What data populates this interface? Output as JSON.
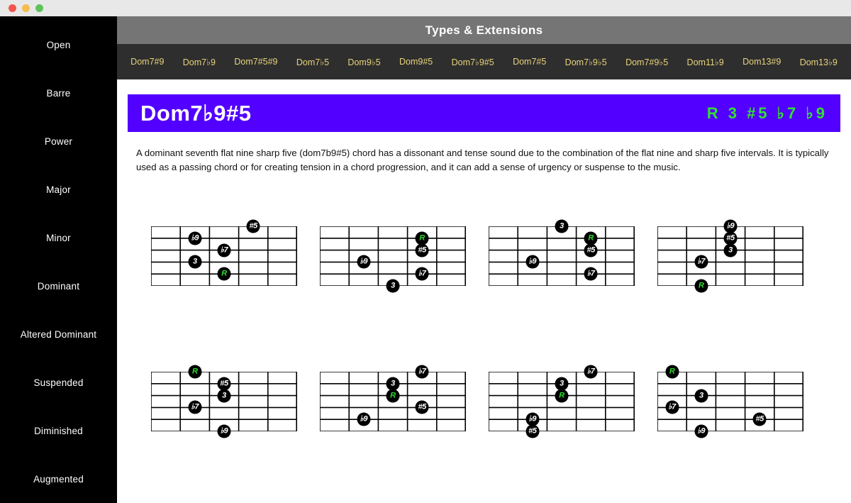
{
  "window": {
    "buttons": [
      "close",
      "minimize",
      "zoom"
    ]
  },
  "sidebar": {
    "items": [
      {
        "label": "Open"
      },
      {
        "label": "Barre"
      },
      {
        "label": "Power"
      },
      {
        "label": "Major"
      },
      {
        "label": "Minor"
      },
      {
        "label": "Dominant"
      },
      {
        "label": "Altered Dominant"
      },
      {
        "label": "Suspended"
      },
      {
        "label": "Diminished"
      },
      {
        "label": "Augmented"
      }
    ]
  },
  "header": {
    "title": "Types & Extensions"
  },
  "tabs": [
    {
      "label": "Dom7#9"
    },
    {
      "label": "Dom7♭9"
    },
    {
      "label": "Dom7#5#9"
    },
    {
      "label": "Dom7♭5"
    },
    {
      "label": "Dom9♭5"
    },
    {
      "label": "Dom9#5"
    },
    {
      "label": "Dom7♭9#5"
    },
    {
      "label": "Dom7#5"
    },
    {
      "label": "Dom7♭9♭5"
    },
    {
      "label": "Dom7#9♭5"
    },
    {
      "label": "Dom11♭9"
    },
    {
      "label": "Dom13#9"
    },
    {
      "label": "Dom13♭9"
    }
  ],
  "banner": {
    "title": "Dom7♭9#5",
    "intervals": "R  3  #5  ♭7  ♭9",
    "background_color": "#5200ff",
    "interval_color": "#33e034"
  },
  "description": "A dominant seventh flat nine sharp five (dom7b9#5) chord has a dissonant and tense sound due to the combination of the flat nine and sharp five intervals. It is typically used as a passing chord or for creating tension in a chord progression, and it can add a sense of urgency or suspense to the music.",
  "chart_data": {
    "type": "table",
    "title": "Dom7♭9#5 chord voicings",
    "strings": 6,
    "frets": 5,
    "note_labels": [
      "R",
      "3",
      "#5",
      "♭7",
      "♭9"
    ],
    "root_color": "#2fdc2f",
    "note_color": "#ffffff",
    "diagrams": [
      {
        "id": 1,
        "notes": [
          {
            "label": "#5",
            "string": 1,
            "fret": 4
          },
          {
            "label": "♭9",
            "string": 2,
            "fret": 2
          },
          {
            "label": "♭7",
            "string": 3,
            "fret": 3
          },
          {
            "label": "3",
            "string": 4,
            "fret": 2
          },
          {
            "label": "R",
            "string": 5,
            "fret": 3,
            "root": true
          }
        ]
      },
      {
        "id": 2,
        "notes": [
          {
            "label": "R",
            "string": 2,
            "fret": 4,
            "root": true
          },
          {
            "label": "#5",
            "string": 3,
            "fret": 4
          },
          {
            "label": "♭9",
            "string": 4,
            "fret": 2
          },
          {
            "label": "♭7",
            "string": 5,
            "fret": 4
          },
          {
            "label": "3",
            "string": 6,
            "fret": 3
          }
        ]
      },
      {
        "id": 3,
        "notes": [
          {
            "label": "3",
            "string": 1,
            "fret": 3
          },
          {
            "label": "R",
            "string": 2,
            "fret": 4,
            "root": true
          },
          {
            "label": "#5",
            "string": 3,
            "fret": 4
          },
          {
            "label": "♭9",
            "string": 4,
            "fret": 2
          },
          {
            "label": "♭7",
            "string": 5,
            "fret": 4
          }
        ]
      },
      {
        "id": 4,
        "notes": [
          {
            "label": "♭9",
            "string": 1,
            "fret": 3
          },
          {
            "label": "#5",
            "string": 2,
            "fret": 3
          },
          {
            "label": "3",
            "string": 3,
            "fret": 3
          },
          {
            "label": "♭7",
            "string": 4,
            "fret": 2
          },
          {
            "label": "R",
            "string": 6,
            "fret": 2,
            "root": true
          }
        ]
      },
      {
        "id": 5,
        "notes": [
          {
            "label": "R",
            "string": 1,
            "fret": 2,
            "root": true
          },
          {
            "label": "#5",
            "string": 2,
            "fret": 3
          },
          {
            "label": "3",
            "string": 3,
            "fret": 3
          },
          {
            "label": "♭7",
            "string": 4,
            "fret": 2
          },
          {
            "label": "♭9",
            "string": 6,
            "fret": 3
          }
        ]
      },
      {
        "id": 6,
        "notes": [
          {
            "label": "♭7",
            "string": 1,
            "fret": 4
          },
          {
            "label": "3",
            "string": 2,
            "fret": 3
          },
          {
            "label": "R",
            "string": 3,
            "fret": 3,
            "root": true
          },
          {
            "label": "#5",
            "string": 4,
            "fret": 4
          },
          {
            "label": "♭9",
            "string": 5,
            "fret": 2
          }
        ]
      },
      {
        "id": 7,
        "notes": [
          {
            "label": "♭7",
            "string": 1,
            "fret": 4
          },
          {
            "label": "3",
            "string": 2,
            "fret": 3
          },
          {
            "label": "R",
            "string": 3,
            "fret": 3,
            "root": true
          },
          {
            "label": "♭9",
            "string": 5,
            "fret": 2
          },
          {
            "label": "#5",
            "string": 6,
            "fret": 2
          }
        ]
      },
      {
        "id": 8,
        "notes": [
          {
            "label": "R",
            "string": 1,
            "fret": 1,
            "root": true
          },
          {
            "label": "3",
            "string": 3,
            "fret": 2
          },
          {
            "label": "♭7",
            "string": 4,
            "fret": 1
          },
          {
            "label": "#5",
            "string": 5,
            "fret": 4
          },
          {
            "label": "♭9",
            "string": 6,
            "fret": 2
          }
        ]
      }
    ]
  }
}
